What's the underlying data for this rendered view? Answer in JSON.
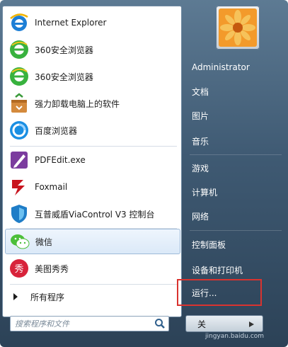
{
  "programs": [
    {
      "label": "Internet Explorer",
      "icon": "internet-explorer-icon"
    },
    {
      "label": "360安全浏览器",
      "icon": "360-browser-icon"
    },
    {
      "label": "360安全浏览器",
      "icon": "360-browser-icon"
    },
    {
      "label": "强力卸载电脑上的软件",
      "icon": "uninstaller-icon"
    },
    {
      "label": "百度浏览器",
      "icon": "baidu-browser-icon"
    },
    {
      "label": "PDFEdit.exe",
      "icon": "pdfedit-icon"
    },
    {
      "label": "Foxmail",
      "icon": "foxmail-icon"
    },
    {
      "label": "互普威盾ViaControl V3 控制台",
      "icon": "viacontrol-shield-icon"
    },
    {
      "label": "微信",
      "icon": "wechat-icon"
    },
    {
      "label": "美图秀秀",
      "icon": "meitu-icon"
    }
  ],
  "all_programs_label": "所有程序",
  "search": {
    "placeholder": "搜索程序和文件"
  },
  "right_menu": {
    "user": "Administrator",
    "documents": "文档",
    "pictures": "图片",
    "music": "音乐",
    "games": "游戏",
    "computer": "计算机",
    "network": "网络",
    "control_panel": "控制面板",
    "devices_printers": "设备和打印机",
    "run": "运行..."
  },
  "shutdown_label": "关",
  "watermark": "jingyan.baidu.com",
  "colors": {
    "highlight_box": "#d9332f",
    "selected_row": "#dbe9f8"
  }
}
